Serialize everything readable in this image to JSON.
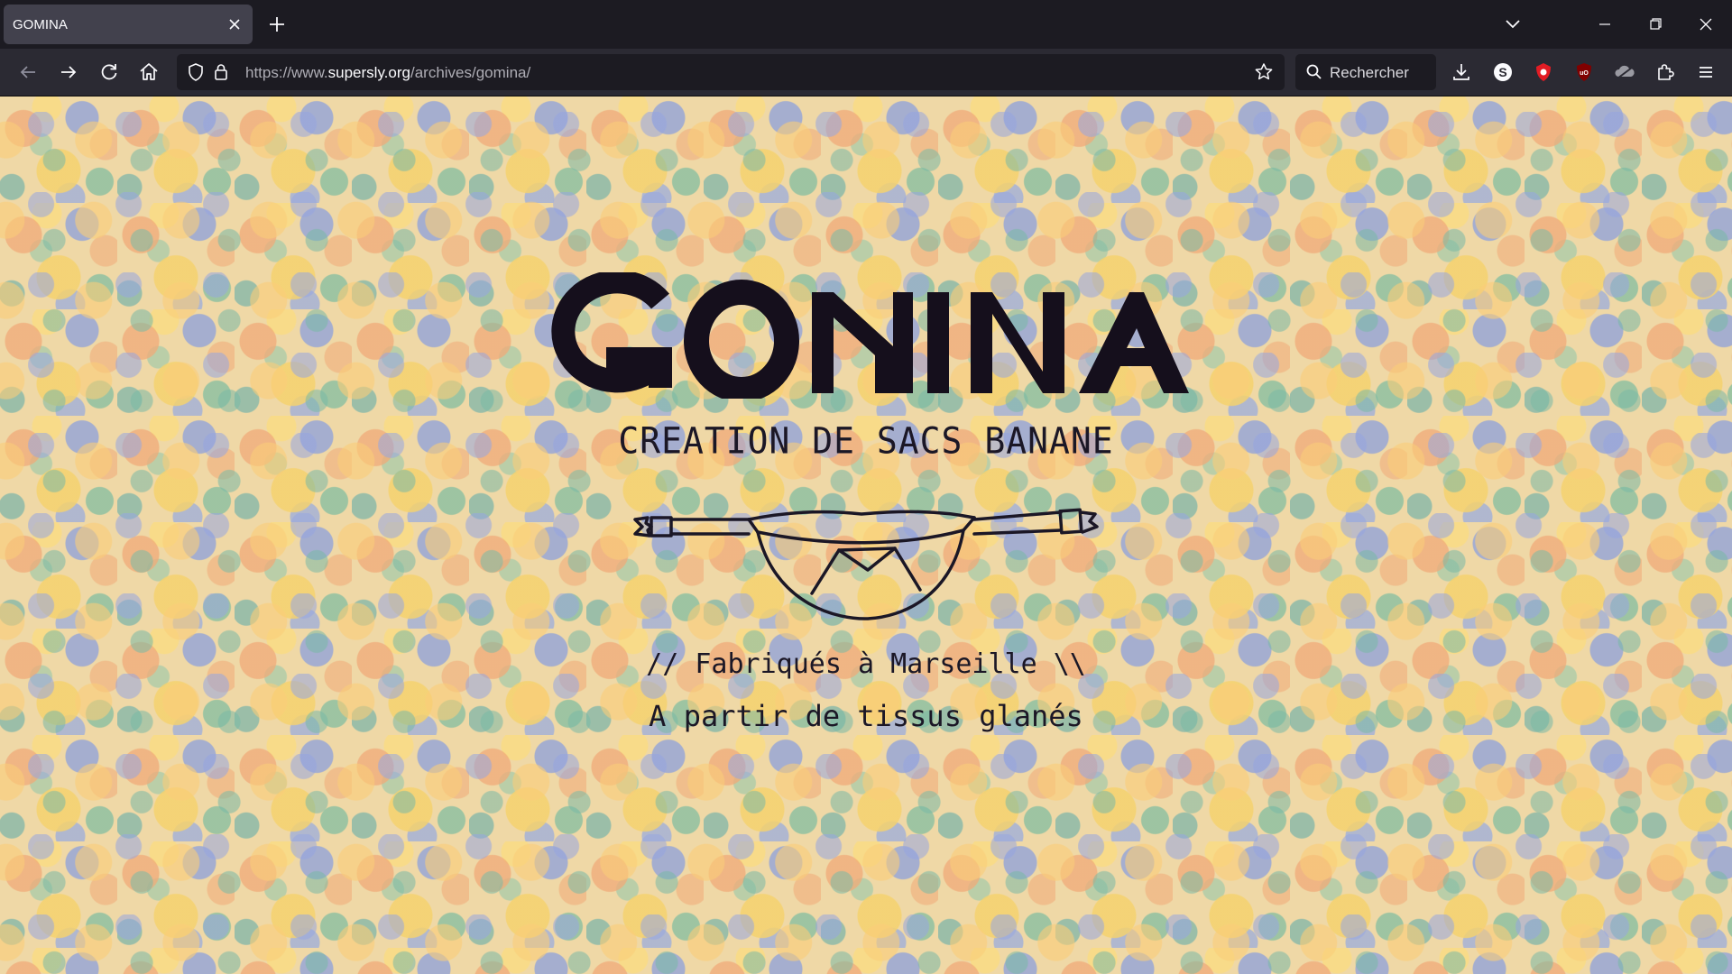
{
  "browser": {
    "tab_title": "GOMINA",
    "url": {
      "scheme": "https://www.",
      "host": "supersly.org",
      "path": "/archives/gomina/"
    },
    "search_placeholder": "Rechercher",
    "icons": {
      "back": "arrow-left-icon",
      "forward": "arrow-right-icon",
      "reload": "reload-icon",
      "home": "home-icon",
      "tracking": "shield-icon",
      "lock": "lock-icon",
      "bookmark": "star-icon",
      "search": "search-icon",
      "downloads": "download-icon",
      "menu": "hamburger-icon"
    },
    "extensions": [
      "s-extension-icon",
      "red-shield-extension-icon",
      "ublock-icon",
      "cloud-extension-icon",
      "puzzle-extensions-icon"
    ]
  },
  "page": {
    "logo_text": "GOMINA",
    "subtitle": "CREATION DE SACS BANANE",
    "line1": "// Fabriqués à Marseille \\\\",
    "line2": "A partir de tissus glanés",
    "colors": {
      "ink": "#1b1726",
      "background_floral": [
        "#f3c879",
        "#f0a878",
        "#8fa3dc",
        "#86bfa6",
        "#f6e6c4"
      ]
    }
  }
}
